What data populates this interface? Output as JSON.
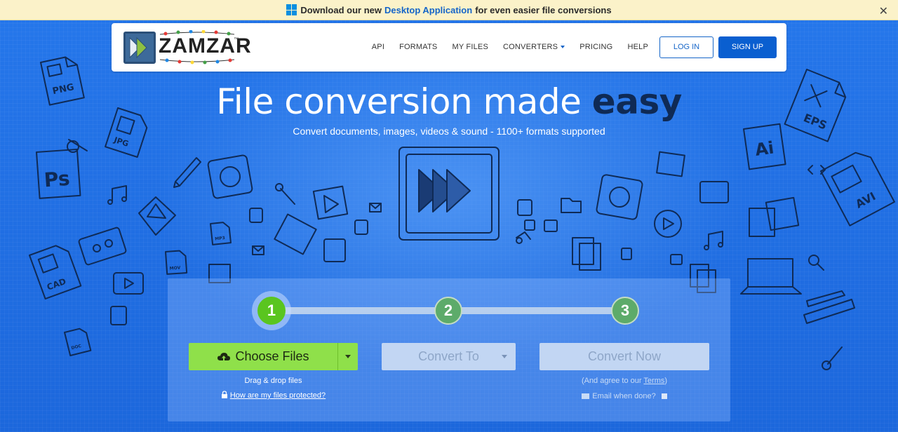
{
  "banner": {
    "prefix": "Download our new",
    "link": "Desktop Application",
    "suffix": "for even easier file conversions",
    "close": "✕"
  },
  "logo": {
    "text": "ZAMZAR",
    "tm": "™"
  },
  "nav": {
    "items": [
      "API",
      "FORMATS",
      "MY FILES",
      "CONVERTERS",
      "PRICING",
      "HELP"
    ],
    "login": "LOG IN",
    "signup": "SIGN UP"
  },
  "hero": {
    "title_main": "File conversion made",
    "title_em": "easy",
    "subtitle": "Convert documents, images, videos & sound - 1100+ formats supported"
  },
  "background": {
    "doodle_labels": [
      "PNG",
      "JPG",
      "Ps",
      "CAD",
      "EPS",
      "Ai",
      "AVI",
      "MP3",
      "MOV",
      "DOC"
    ]
  },
  "converter": {
    "steps": [
      "1",
      "2",
      "3"
    ],
    "choose_files": "Choose Files",
    "drag_drop": "Drag & drop files",
    "protected": "How are my files protected?",
    "convert_to": "Convert To",
    "convert_now": "Convert Now",
    "agree_prefix": "(And agree to our",
    "agree_terms": "Terms",
    "agree_suffix": ")",
    "email_when_done": "Email when done?"
  },
  "colors": {
    "brand_blue": "#0a5fd0",
    "step_active": "#5ac51f",
    "choose_button": "#8fe04a",
    "banner_bg": "#fbf2c9"
  }
}
